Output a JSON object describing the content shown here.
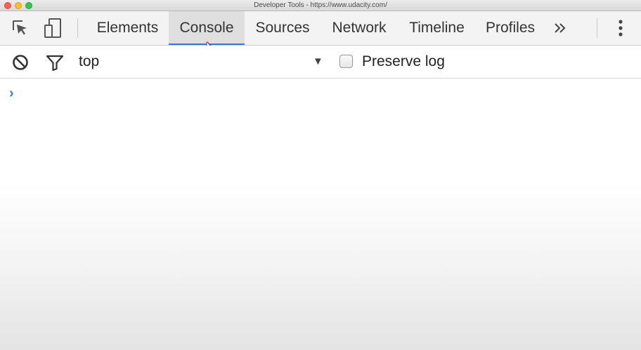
{
  "window": {
    "title": "Developer Tools - https://www.udacity.com/"
  },
  "toolbar": {
    "icons": {
      "inspect": "inspect-element-icon",
      "device": "device-mode-icon",
      "more_tabs": "chevron-double-right-icon",
      "menu": "vertical-ellipsis-icon"
    },
    "tabs": [
      {
        "label": "Elements",
        "active": false
      },
      {
        "label": "Console",
        "active": true
      },
      {
        "label": "Sources",
        "active": false
      },
      {
        "label": "Network",
        "active": false
      },
      {
        "label": "Timeline",
        "active": false
      },
      {
        "label": "Profiles",
        "active": false
      }
    ],
    "more_label": "»"
  },
  "console_bar": {
    "icons": {
      "clear": "clear-console-icon",
      "filter": "filter-icon"
    },
    "context": "top",
    "context_arrow": "▼",
    "preserve_log": {
      "label": "Preserve log",
      "checked": false
    }
  },
  "console": {
    "prompt": "›",
    "input_value": ""
  },
  "colors": {
    "accent": "#3879d9",
    "prompt": "#3c7ee0",
    "toolbar_bg": "#f3f3f3",
    "active_tab_bg": "#dfdfdf"
  }
}
